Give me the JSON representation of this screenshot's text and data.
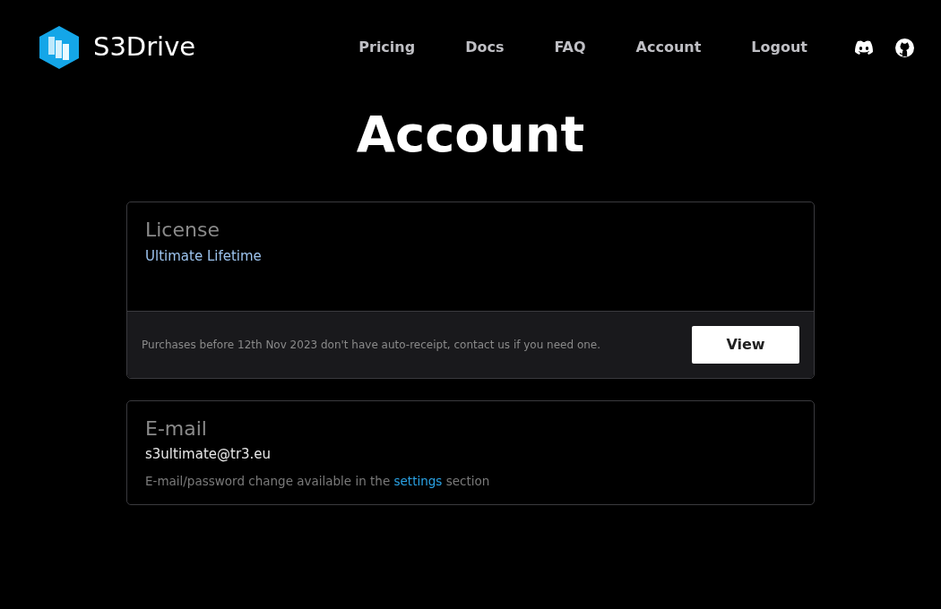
{
  "brand": {
    "name": "S3Drive"
  },
  "nav": [
    {
      "label": "Pricing"
    },
    {
      "label": "Docs"
    },
    {
      "label": "FAQ"
    },
    {
      "label": "Account"
    },
    {
      "label": "Logout"
    }
  ],
  "page_title": "Account",
  "license": {
    "title": "License",
    "value": "Ultimate Lifetime",
    "footer_note": "Purchases before 12th Nov 2023 don't have auto-receipt, contact us if you need one.",
    "button": "View"
  },
  "email": {
    "title": "E-mail",
    "value": "s3ultimate@tr3.eu",
    "hint_before": "E-mail/password change available in the ",
    "hint_link": "settings",
    "hint_after": " section"
  }
}
